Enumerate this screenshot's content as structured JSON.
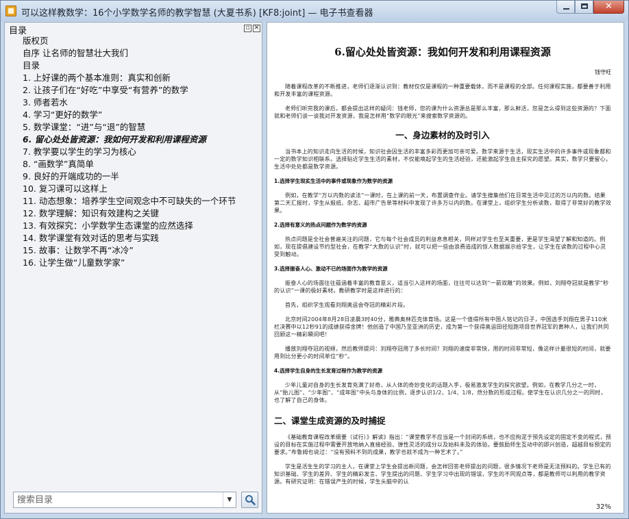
{
  "window": {
    "title": "可以这样教数学：16个小学数学名师的教学智慧 (大夏书系) [KF8:joint] — 电子书查看器"
  },
  "toc": {
    "heading": "目录",
    "items": [
      "版权页",
      "自序  让名师的智慧壮大我们",
      "目录",
      "1. 上好课的两个基本准则：真实和创新",
      "2. 让孩子们在“好吃”中享受“有营养”的数学",
      "3. 师者若水",
      "4. 学习“更好的数学”",
      "5. 数学课堂：“进”与“退”的智慧",
      "6. 留心处处皆资源：我如何开发和利用课程资源",
      "7. 教学要以学生的学习为核心",
      "8. “画数学”真简单",
      "9. 良好的开端成功的一半",
      "10. 复习课可以这样上",
      "11. 动态想象：培养学生空间观念中不可缺失的一个环节",
      "12. 数学理解：知识有效建构之关键",
      "13. 有效探究：小学数学生态课堂的应然选择",
      "14. 数学课堂有效对话的思考与实践",
      "15. 故事：让数学不再“冰冷”",
      "16. 让学生做“儿童数学家”"
    ],
    "search_placeholder": "搜索目录"
  },
  "doc": {
    "chapter_title": "6.留心处处皆资源：我如何开发和利用课程资源",
    "author": "钱守旺",
    "p1": "随着课程改革的不断推进，老师们逐渐认识到：教材仅仅是课程的一种重要载体，而不是课程的全部。任何课程实施，都要善于利用和开发丰富的课程资源。",
    "p2": "老师们听完我的课后，都会提出这样的疑问：钱老师，您的课为什么资源总是那么丰富，那么鲜活，您是怎么得到这些资源的？下面就和老师们谈一谈我对开发资源，我是怎样用“数学的眼光”来搜索数学资源的。",
    "s1_title": "一、身边素材的及时引入",
    "p3": "当书本上的知识走向生活的时候，知识社会因生活的丰富多彩而更加可亲可爱。数学来源于生活，现实生活中的许多事件或现象都和一定的数学知识相联系。选择贴近学生生活的素材，不仅能唤起学生的生活经验，还能激起学生自主探究的愿望。其实，数学只要留心，生活中处处都是数学资源。",
    "h3_1": "1.选择学生现实生活中的事件或现象作为数学的资源",
    "p4": "例如，在教学“万以内数的读法”一课时，在上课的前一天，布置调查作业。请学生搜集他们在日常生活中见过的万以内的数。结果第二天汇报时，学生从报纸、杂志、超市广告单等材料中发现了许多万以内的数。在课堂上，组织学生分析读数，取得了非常好的教学效果。",
    "h3_2": "2.选择有意义的热点问题作为数学的资源",
    "p5": "热点问题是全社会普遍关注的问题，它与每个社会成员的利益息息相关，同样对学生也至关重要，更是学生渴望了解和知道的。例如，现在提倡建设节约型社会，在教学“大数的认识”时，就可以把一些由浪费造成的惊人数据展示给学生，让学生在读数的过程中心灵受到触动。",
    "h3_3": "3.选择振奋人心、激动不已的场面作为教学的资源",
    "p6": "振奋人心的场面往往蕴涵着丰富的教育意义，适当引入这样的场面，往往可以达到“一箭双雕”的效果。例如，刘翔夺冠就是教学“秒的认识”一课的极好素材。教研教学时是这样进行的：",
    "p7": "首先，组织学生观看刘翔奥运会夺冠的精彩片段。",
    "p8": "北京时间2004年8月28日凌晨3时40分，雅典奥林匹克体育场。这是一个值得所有中国人铭记的日子，中国选手刘翔在男子110米栏决赛中以12秒91的成绩获得金牌！他创造了中国乃至亚洲的历史，成为第一个获得奥运田径短跑项目世界冠军的黄种人，让我们共同回顾这一精彩瞬间吧！",
    "p9": "播放刘翔夺冠的视频，然后教师提问：刘翔夺冠用了多长时间？刘翔的速度非常快，用的时间非常短，像这样计量很短的时间，就要用到比分更小的时间单位“秒”。",
    "h3_4": "4.选择学生自身的生长发育过程作为教学的资源",
    "p10": "少年儿童对自身的生长发育充满了好奇，从人体的奇妙变化的话题入手，极易激发学生的探究欲望。例如，在教学几分之一时，从“胎儿图”、“少年图”、“成年图”中头与身体的比例，逐步认识1/2、1/4、1/8，然分数的形成过程。使学生在认识几分之一的同时，也了解了自己的身体。",
    "s2_title": "二、课堂生成资源的及时捕捉",
    "p11": "《基础教育课程改革纲要（试行）》解读》指出：“课堂教学不应当是一个封闭的系统，也不应拘泥于预先设定的固定不变的程式，预设的目标在实施过程中需要开放地纳入直接经验、弹性灵活的成分以及始料未及的体验。要鼓励师生互动中的即兴创造，超越目标预定的要求。”布鲁姆也说过：“没有预料不到的成果，教学也就不成为一种艺术了。”",
    "p12": "学生是活生生的学习的主人，在课堂上学生会提出新问题，会怎样回答老师提出的问题，很多情况下老师是无法预料的。学生已有的知识基础、学生的差异、学生的精彩发言、学生提出的问题、学生学习中出现的错误，学生的不同观点等，都是教师可以利用的教学资源。有研究证明：在错误产生的时候，学生头脑中的认",
    "zoom": "32%"
  },
  "colors": {
    "title_bar": "#c7d7ea",
    "pane_bg": "#f1f3f6",
    "page_bg": "#ffffff"
  },
  "icons": {
    "app": "book-app-icon",
    "search": "magnifier-icon"
  }
}
